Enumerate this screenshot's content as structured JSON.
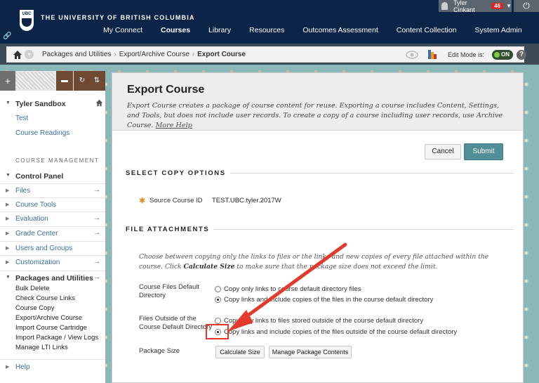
{
  "header": {
    "logo_text": "UBC",
    "university_name": "THE UNIVERSITY OF BRITISH COLUMBIA",
    "user_name": "Tyler Cinkant",
    "notification_count": "46",
    "nav_tabs": [
      {
        "label": "My Connect"
      },
      {
        "label": "Courses"
      },
      {
        "label": "Library"
      },
      {
        "label": "Resources"
      },
      {
        "label": "Outcomes Assessment"
      },
      {
        "label": "Content Collection"
      },
      {
        "label": "System Admin"
      }
    ]
  },
  "breadcrumb": {
    "items": [
      "Packages and Utilities",
      "Export/Archive Course",
      "Export Course"
    ],
    "edit_mode_label": "Edit Mode is:",
    "edit_mode_state": "ON",
    "help_symbol": "?"
  },
  "sidebar": {
    "course_title": "Tyler Sandbox",
    "course_links": [
      "Test",
      "Course Readings"
    ],
    "management_label": "COURSE MANAGEMENT",
    "control_panel_label": "Control Panel",
    "control_panel_items": [
      "Files",
      "Course Tools",
      "Evaluation",
      "Grade Center",
      "Users and Groups",
      "Customization"
    ],
    "packages_label": "Packages and Utilities",
    "packages_subitems": [
      "Bulk Delete",
      "Check Course Links",
      "Course Copy",
      "Export/Archive Course",
      "Import Course Cartridge",
      "Import Package / View Logs",
      "Manage LTI Links"
    ],
    "help_label": "Help"
  },
  "main": {
    "title": "Export Course",
    "description": "Export Course creates a package of course content for reuse. Exporting a course includes Content, Settings, and Tools, but does not include user records. To create a copy of a course including user records, use Archive Course.",
    "more_help": "More Help",
    "cancel_label": "Cancel",
    "submit_label": "Submit",
    "select_copy_heading": "SELECT COPY OPTIONS",
    "source_course_label": "Source Course ID",
    "source_course_value": "TEST.UBC.tyler.2017W",
    "file_attachments_heading": "FILE ATTACHMENTS",
    "fa_desc_pre": "Choose between copying only the links to files or the links and new copies of every file attached within the course. Click ",
    "fa_desc_bold": "Calculate Size",
    "fa_desc_post": " to make sure that the package size does not exceed the limit.",
    "course_files_label_1": "Course Files Default",
    "course_files_label_2": "Directory",
    "course_files_options": [
      {
        "label": "Copy only links to course default directory files",
        "checked": false
      },
      {
        "label": "Copy links and include copies of the files in the course default directory",
        "checked": true
      }
    ],
    "files_outside_label_1": "Files Outside of the",
    "files_outside_label_2": "Course Default Directory",
    "files_outside_options": [
      {
        "label": "Copy only links to files stored outside of the course default directory",
        "checked": false
      },
      {
        "label": "Copy links and include copies of the files outside of the course default directory",
        "checked": true
      }
    ],
    "package_size_label": "Package Size",
    "calculate_size_label": "Calculate Size",
    "manage_contents_label": "Manage Package Contents"
  },
  "annotation": {
    "arrow_color": "#e23b2e"
  }
}
